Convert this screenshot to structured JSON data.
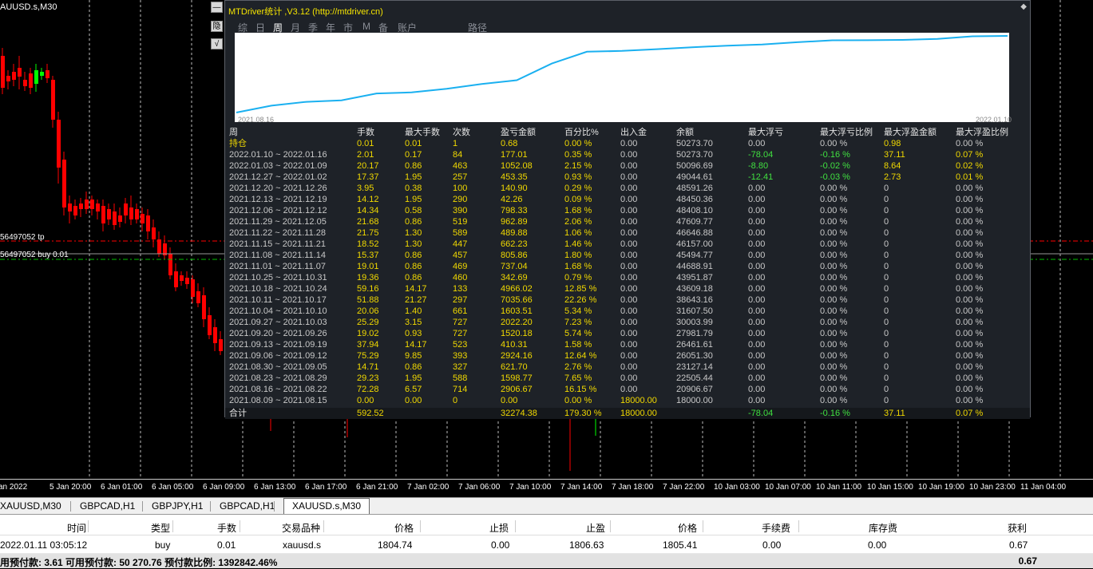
{
  "chart": {
    "symbol_title": "AUUSD.s,M30",
    "order_tp_label": "56497052 tp",
    "order_buy_label": "56497052 buy 0.01",
    "side_buttons": [
      "—",
      "隐",
      "√"
    ],
    "time_ticks": [
      "an 2022",
      "5 Jan 20:00",
      "6 Jan 01:00",
      "6 Jan 05:00",
      "6 Jan 09:00",
      "6 Jan 13:00",
      "6 Jan 17:00",
      "6 Jan 21:00",
      "7 Jan 02:00",
      "7 Jan 06:00",
      "7 Jan 10:00",
      "7 Jan 14:00",
      "7 Jan 18:00",
      "7 Jan 22:00",
      "10 Jan 03:00",
      "10 Jan 07:00",
      "10 Jan 11:00",
      "10 Jan 15:00",
      "10 Jan 19:00",
      "10 Jan 23:00",
      "11 Jan 04:00"
    ],
    "colors": {
      "bull": "#00ff00",
      "bear": "#ff0000",
      "tp_line": "#ff0000",
      "buy_line": "#00c000"
    }
  },
  "panel": {
    "title": "MTDriver统计 ,V3.12 (http://mtdriver.cn)",
    "tabs": [
      "综",
      "日",
      "周",
      "月",
      "季",
      "年",
      "市",
      "M",
      "备",
      "账户",
      "路径"
    ],
    "active_tab": "周",
    "equity_start_date": "2021.08.16",
    "equity_end_date": "2022.01.10",
    "equity_curve_color": "#1ab0f0",
    "equity_curve": [
      18000.0,
      20906.67,
      22505.44,
      23127.14,
      26051.3,
      26461.61,
      27981.79,
      30003.99,
      31607.5,
      38643.16,
      43609.18,
      43951.87,
      44688.91,
      45494.77,
      46157.0,
      46646.88,
      47609.77,
      48408.1,
      48450.36,
      48591.26,
      49044.61,
      50096.69,
      50273.7
    ],
    "columns": [
      "周",
      "手数",
      "最大手数",
      "次数",
      "盈亏金额",
      "百分比%",
      "出入金",
      "余额",
      "最大浮亏",
      "最大浮亏比例",
      "最大浮盈金额",
      "最大浮盈比例"
    ],
    "rows": [
      [
        "持仓",
        "0.01",
        "0.01",
        "1",
        "0.68",
        "0.00 %",
        "0.00",
        "50273.70",
        "0.00",
        "0.00 %",
        "0.98",
        "0.00 %"
      ],
      [
        "2022.01.10 ~ 2022.01.16",
        "2.01",
        "0.17",
        "84",
        "177.01",
        "0.35 %",
        "0.00",
        "50273.70",
        "-78.04",
        "-0.16 %",
        "37.11",
        "0.07 %"
      ],
      [
        "2022.01.03 ~ 2022.01.09",
        "20.17",
        "0.86",
        "463",
        "1052.08",
        "2.15 %",
        "0.00",
        "50096.69",
        "-8.80",
        "-0.02 %",
        "8.64",
        "0.02 %"
      ],
      [
        "2021.12.27 ~ 2022.01.02",
        "17.37",
        "1.95",
        "257",
        "453.35",
        "0.93 %",
        "0.00",
        "49044.61",
        "-12.41",
        "-0.03 %",
        "2.73",
        "0.01 %"
      ],
      [
        "2021.12.20 ~ 2021.12.26",
        "3.95",
        "0.38",
        "100",
        "140.90",
        "0.29 %",
        "0.00",
        "48591.26",
        "0.00",
        "0.00 %",
        "0",
        "0.00 %"
      ],
      [
        "2021.12.13 ~ 2021.12.19",
        "14.12",
        "1.95",
        "290",
        "42.26",
        "0.09 %",
        "0.00",
        "48450.36",
        "0.00",
        "0.00 %",
        "0",
        "0.00 %"
      ],
      [
        "2021.12.06 ~ 2021.12.12",
        "14.34",
        "0.58",
        "390",
        "798.33",
        "1.68 %",
        "0.00",
        "48408.10",
        "0.00",
        "0.00 %",
        "0",
        "0.00 %"
      ],
      [
        "2021.11.29 ~ 2021.12.05",
        "21.68",
        "0.86",
        "519",
        "962.89",
        "2.06 %",
        "0.00",
        "47609.77",
        "0.00",
        "0.00 %",
        "0",
        "0.00 %"
      ],
      [
        "2021.11.22 ~ 2021.11.28",
        "21.75",
        "1.30",
        "589",
        "489.88",
        "1.06 %",
        "0.00",
        "46646.88",
        "0.00",
        "0.00 %",
        "0",
        "0.00 %"
      ],
      [
        "2021.11.15 ~ 2021.11.21",
        "18.52",
        "1.30",
        "447",
        "662.23",
        "1.46 %",
        "0.00",
        "46157.00",
        "0.00",
        "0.00 %",
        "0",
        "0.00 %"
      ],
      [
        "2021.11.08 ~ 2021.11.14",
        "15.37",
        "0.86",
        "457",
        "805.86",
        "1.80 %",
        "0.00",
        "45494.77",
        "0.00",
        "0.00 %",
        "0",
        "0.00 %"
      ],
      [
        "2021.11.01 ~ 2021.11.07",
        "19.01",
        "0.86",
        "469",
        "737.04",
        "1.68 %",
        "0.00",
        "44688.91",
        "0.00",
        "0.00 %",
        "0",
        "0.00 %"
      ],
      [
        "2021.10.25 ~ 2021.10.31",
        "19.36",
        "0.86",
        "460",
        "342.69",
        "0.79 %",
        "0.00",
        "43951.87",
        "0.00",
        "0.00 %",
        "0",
        "0.00 %"
      ],
      [
        "2021.10.18 ~ 2021.10.24",
        "59.16",
        "14.17",
        "133",
        "4966.02",
        "12.85 %",
        "0.00",
        "43609.18",
        "0.00",
        "0.00 %",
        "0",
        "0.00 %"
      ],
      [
        "2021.10.11 ~ 2021.10.17",
        "51.88",
        "21.27",
        "297",
        "7035.66",
        "22.26 %",
        "0.00",
        "38643.16",
        "0.00",
        "0.00 %",
        "0",
        "0.00 %"
      ],
      [
        "2021.10.04 ~ 2021.10.10",
        "20.06",
        "1.40",
        "661",
        "1603.51",
        "5.34 %",
        "0.00",
        "31607.50",
        "0.00",
        "0.00 %",
        "0",
        "0.00 %"
      ],
      [
        "2021.09.27 ~ 2021.10.03",
        "25.29",
        "3.15",
        "727",
        "2022.20",
        "7.23 %",
        "0.00",
        "30003.99",
        "0.00",
        "0.00 %",
        "0",
        "0.00 %"
      ],
      [
        "2021.09.20 ~ 2021.09.26",
        "19.02",
        "0.93",
        "727",
        "1520.18",
        "5.74 %",
        "0.00",
        "27981.79",
        "0.00",
        "0.00 %",
        "0",
        "0.00 %"
      ],
      [
        "2021.09.13 ~ 2021.09.19",
        "37.94",
        "14.17",
        "523",
        "410.31",
        "1.58 %",
        "0.00",
        "26461.61",
        "0.00",
        "0.00 %",
        "0",
        "0.00 %"
      ],
      [
        "2021.09.06 ~ 2021.09.12",
        "75.29",
        "9.85",
        "393",
        "2924.16",
        "12.64 %",
        "0.00",
        "26051.30",
        "0.00",
        "0.00 %",
        "0",
        "0.00 %"
      ],
      [
        "2021.08.30 ~ 2021.09.05",
        "14.71",
        "0.86",
        "327",
        "621.70",
        "2.76 %",
        "0.00",
        "23127.14",
        "0.00",
        "0.00 %",
        "0",
        "0.00 %"
      ],
      [
        "2021.08.23 ~ 2021.08.29",
        "29.23",
        "1.95",
        "588",
        "1598.77",
        "7.65 %",
        "0.00",
        "22505.44",
        "0.00",
        "0.00 %",
        "0",
        "0.00 %"
      ],
      [
        "2021.08.16 ~ 2021.08.22",
        "72.28",
        "6.57",
        "714",
        "2906.67",
        "16.15 %",
        "0.00",
        "20906.67",
        "0.00",
        "0.00 %",
        "0",
        "0.00 %"
      ],
      [
        "2021.08.09 ~ 2021.08.15",
        "0.00",
        "0.00",
        "0",
        "0.00",
        "0.00 %",
        "18000.00",
        "18000.00",
        "0.00",
        "0.00 %",
        "0",
        "0.00 %"
      ]
    ],
    "total": [
      "合计",
      "592.52",
      "",
      "",
      "32274.38",
      "179.30 %",
      "18000.00",
      "",
      "-78.04",
      "-0.16 %",
      "37.11",
      "0.07 %"
    ]
  },
  "chart_tabs": [
    "XAUUSD,M30",
    "GBPCAD,H1",
    "GBPJPY,H1",
    "GBPCAD,H1",
    "XAUUSD.s,M30"
  ],
  "active_chart_tab": "XAUUSD.s,M30",
  "terminal": {
    "headers": [
      "时间",
      "类型",
      "手数",
      "交易品种",
      "价格",
      "止损",
      "止盈",
      "价格",
      "手续费",
      "库存费",
      "获利"
    ],
    "row": [
      "2022.01.11 03:05:12",
      "buy",
      "0.01",
      "xauusd.s",
      "1804.74",
      "0.00",
      "1806.63",
      "1805.41",
      "0.00",
      "0.00",
      "0.67"
    ],
    "summary": "用预付款: 3.61  可用预付款: 50 270.76  预付款比例: 1392842.46%",
    "summary_profit": "0.67"
  }
}
